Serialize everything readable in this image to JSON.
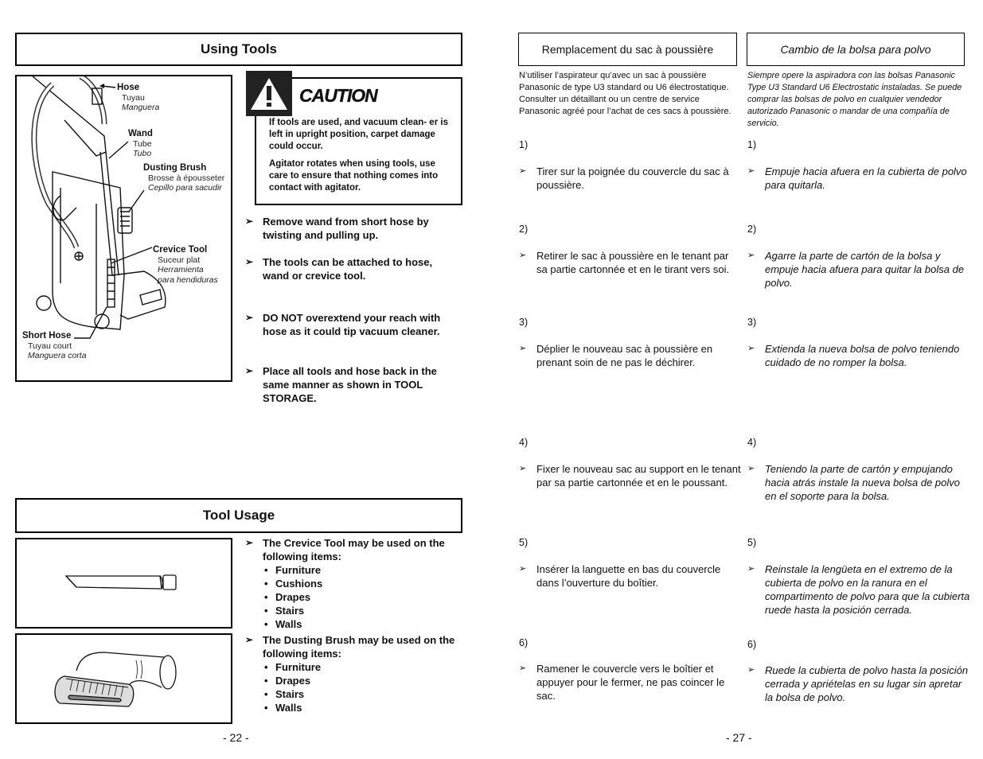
{
  "left_page": {
    "section1": {
      "title": "Using Tools",
      "callouts": [
        {
          "en": "Hose",
          "fr": "Tuyau",
          "es": "Manguera"
        },
        {
          "en": "Wand",
          "fr": "Tube",
          "es": "Tubo"
        },
        {
          "en": "Dusting Brush",
          "fr": "Brosse à épousseter",
          "es": "Cepillo para sacudir"
        },
        {
          "en": "Crevice Tool",
          "fr": "Suceur plat",
          "es": "Herramienta",
          "es2": "para hendiduras"
        },
        {
          "en": "Short Hose",
          "fr": "Tuyau court",
          "es": "Manguera corta"
        }
      ],
      "caution": {
        "icon": "warning-triangle-icon",
        "title": "CAUTION",
        "paragraphs": [
          "If tools are used, and vacuum clean- er is left in upright position, carpet damage could occur.",
          "Agitator rotates when using tools, use care to ensure that nothing comes into contact with agitator."
        ]
      },
      "bullets": [
        "Remove wand from short hose by twisting and pulling up.",
        "The tools can be attached to hose, wand or crevice tool.",
        "DO NOT overextend your reach with hose as it could tip vacuum cleaner.",
        "Place all tools and hose back in the same manner as shown in  TOOL STORAGE."
      ]
    },
    "section2": {
      "title": "Tool Usage",
      "crevice": {
        "intro": "The Crevice Tool may be used on the following items:",
        "items": [
          "Furniture",
          "Cushions",
          "Drapes",
          "Stairs",
          "Walls"
        ]
      },
      "brush": {
        "intro": "The Dusting Brush may be used on the following items:",
        "items": [
          "Furniture",
          "Drapes",
          "Stairs",
          "Walls"
        ]
      }
    },
    "page_number": "- 22 -"
  },
  "right_page": {
    "french": {
      "title": "Remplacement du sac à poussière",
      "intro": "N’utiliser l’aspirateur qu’avec un sac à poussière Panasonic de type U3 standard ou U6 électrostatique. Consulter un détaillant ou un centre de service Panasonic agréé pour l’achat de ces sacs à poussière.",
      "steps": [
        {
          "num": "1)",
          "text": "Tirer sur la poignée du couvercle du sac à poussière."
        },
        {
          "num": "2)",
          "text": "Retirer le sac à poussière en le tenant par sa partie cartonnée et en le tirant vers soi."
        },
        {
          "num": "3)",
          "text": "Déplier le nouveau sac à poussière en prenant soin de ne pas le déchirer."
        },
        {
          "num": "4)",
          "text": "Fixer le nouveau sac au support en le tenant par sa partie cartonnée et en le poussant."
        },
        {
          "num": "5)",
          "text": "Insérer la languette en bas du couvercle dans l’ouverture du boîtier."
        },
        {
          "num": "6)",
          "text": "Ramener le couvercle vers le boîtier et appuyer pour le fermer, ne pas coincer le sac."
        }
      ]
    },
    "spanish": {
      "title": "Cambio de la bolsa para polvo",
      "intro": "Siempre opere la aspiradora con las bolsas Panasonic Type U3 Standard U6 Electrostatic instaladas. Se puede comprar las bolsas de polvo en cualquier vendedor autorizado Panasonic o mandar de una compañía de servicio.",
      "steps": [
        {
          "num": "1)",
          "text": "Empuje hacia afuera en la cubierta de polvo para quitarla."
        },
        {
          "num": "2)",
          "text": "Agarre la parte de cartón de la bolsa y empuje hacia afuera para quitar la bolsa de polvo."
        },
        {
          "num": "3)",
          "text": "Extienda la nueva bolsa de polvo teniendo cuidado de no romper la bolsa."
        },
        {
          "num": "4)",
          "text": "Teniendo la parte de cartón y empujando hacia atrás instale la nueva bolsa de polvo en el soporte para la bolsa."
        },
        {
          "num": "5)",
          "text": "Reinstale la lengüeta en el extremo de la cubierta de polvo en la ranura en el compartimento de polvo para que la cubierta ruede hasta la posición cerrada."
        },
        {
          "num": "6)",
          "text": "Ruede la cubierta de polvo hasta la posición cerrada y apriételas en su lugar sin apretar la bolsa de polvo."
        }
      ]
    },
    "page_number": "- 27 -"
  },
  "bullet_glyph": "➢"
}
